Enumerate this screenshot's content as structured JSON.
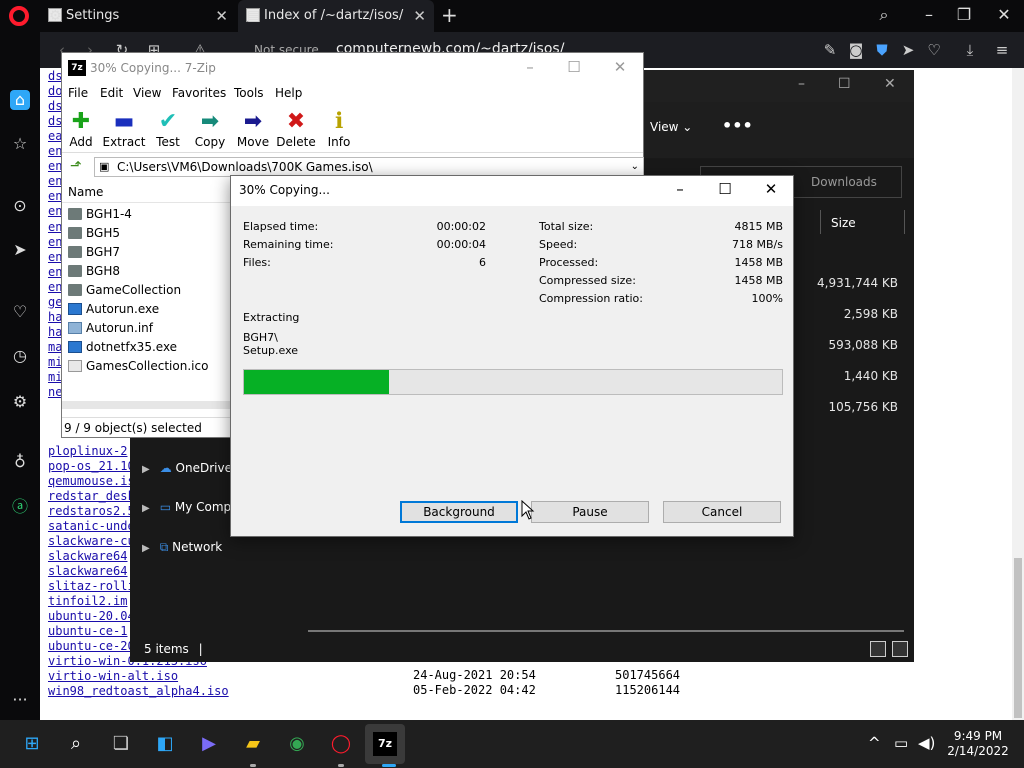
{
  "browser": {
    "tabs": [
      {
        "label": "Settings",
        "icon": "gear-icon"
      },
      {
        "label": "Index of /~dartz/isos/",
        "icon": "page-icon"
      }
    ],
    "not_secure": "Not secure",
    "url": "computernewb.com/~dartz/isos/"
  },
  "webpage": {
    "visible_links": [
      "ploplinux-2",
      "pop-os_21.10",
      "qemumouse.is",
      "redstar_desk",
      "redstaros2.5",
      "satanic-unde",
      "slackware-cu",
      "slackware64",
      "slackware64",
      "slitaz-rolli",
      "tinfoil2.im",
      "ubuntu-20.04",
      "ubuntu-ce-1",
      "ubuntu-ce-20",
      "virtio-win-0.1.215.iso",
      "virtio-win-alt.iso",
      "win98_redtoast_alpha4.iso"
    ],
    "left_column_fragments": [
      "ds",
      "do",
      "ds",
      "ds",
      "ea",
      "en",
      "en",
      "en",
      "en",
      "en",
      "en",
      "en",
      "en",
      "en",
      "en",
      "ge",
      "ha",
      "ha",
      "ma",
      "mi",
      "mi",
      "ne"
    ],
    "bottom_rows": [
      {
        "name": "virtio-win-alt.iso",
        "date": "24-Aug-2021 20:54",
        "size": "501745664"
      },
      {
        "name": "win98_redtoast_alpha4.iso",
        "date": "05-Feb-2022 04:42",
        "size": "115206144"
      }
    ]
  },
  "explorer": {
    "view_label": "View",
    "search_placeholder": "Downloads",
    "size_header": "Size",
    "sizes": [
      "4,931,744 KB",
      "2,598 KB",
      "593,088 KB",
      "1,440 KB",
      "105,756 KB"
    ],
    "nav": [
      "OneDrive",
      "My Comp",
      "Network"
    ],
    "status": "5 items"
  },
  "sevenzip": {
    "title": "30% Copying... 7-Zip",
    "menu": [
      "File",
      "Edit",
      "View",
      "Favorites",
      "Tools",
      "Help"
    ],
    "toolbar": [
      {
        "label": "Add",
        "icon": "plus-icon"
      },
      {
        "label": "Extract",
        "icon": "minus-icon"
      },
      {
        "label": "Test",
        "icon": "checkmark-icon"
      },
      {
        "label": "Copy",
        "icon": "arrow-right-icon"
      },
      {
        "label": "Move",
        "icon": "arrow-move-icon"
      },
      {
        "label": "Delete",
        "icon": "x-icon"
      },
      {
        "label": "Info",
        "icon": "info-icon"
      }
    ],
    "path": "C:\\Users\\VM6\\Downloads\\700K Games.iso\\",
    "column_name": "Name",
    "files": [
      {
        "name": "BGH1-4",
        "type": "folder"
      },
      {
        "name": "BGH5",
        "type": "folder"
      },
      {
        "name": "BGH7",
        "type": "folder"
      },
      {
        "name": "BGH8",
        "type": "folder"
      },
      {
        "name": "GameCollection",
        "type": "folder"
      },
      {
        "name": "Autorun.exe",
        "type": "exe"
      },
      {
        "name": "Autorun.inf",
        "type": "inf"
      },
      {
        "name": "dotnetfx35.exe",
        "type": "exe"
      },
      {
        "name": "GamesCollection.ico",
        "type": "ico"
      }
    ],
    "status": "9 / 9 object(s) selected"
  },
  "dialog": {
    "title": "30% Copying...",
    "left": [
      {
        "label": "Elapsed time:",
        "value": "00:00:02"
      },
      {
        "label": "Remaining time:",
        "value": "00:00:04"
      },
      {
        "label": "Files:",
        "value": "6"
      }
    ],
    "right": [
      {
        "label": "Total size:",
        "value": "4815 MB"
      },
      {
        "label": "Speed:",
        "value": "718 MB/s"
      },
      {
        "label": "Processed:",
        "value": "1458 MB"
      },
      {
        "label": "Compressed size:",
        "value": "1458 MB"
      },
      {
        "label": "Compression ratio:",
        "value": "100%"
      }
    ],
    "action": "Extracting",
    "current_dir": "BGH7\\",
    "current_file": "Setup.exe",
    "progress_percent": 27,
    "buttons": {
      "background": "Background",
      "pause": "Pause",
      "cancel": "Cancel"
    }
  },
  "taskbar": {
    "time": "9:49 PM",
    "date": "2/14/2022"
  },
  "colors": {
    "progress": "#06b025",
    "opera_red": "#ff1b2d",
    "link": "#1a0dab"
  }
}
